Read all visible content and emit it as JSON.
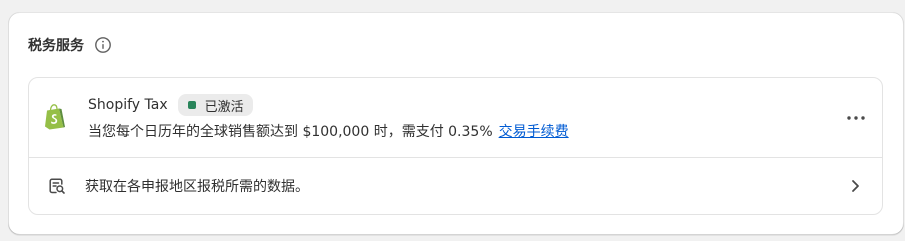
{
  "card": {
    "title": "税务服务",
    "info_icon": "info-icon"
  },
  "app": {
    "name": "Shopify Tax",
    "logo_icon": "shopify-bag-icon",
    "status": "已激活",
    "status_color": "#29845a",
    "description": "当您每个日历年的全球销售额达到 $100,000 时，需支付 0.35%",
    "fee_link": "交易手续费",
    "link_color": "#005bd3",
    "more_icon": "ellipsis-icon"
  },
  "report": {
    "icon": "report-search-icon",
    "label": "获取在各申报地区报税所需的数据。",
    "chevron_icon": "chevron-right-icon"
  }
}
